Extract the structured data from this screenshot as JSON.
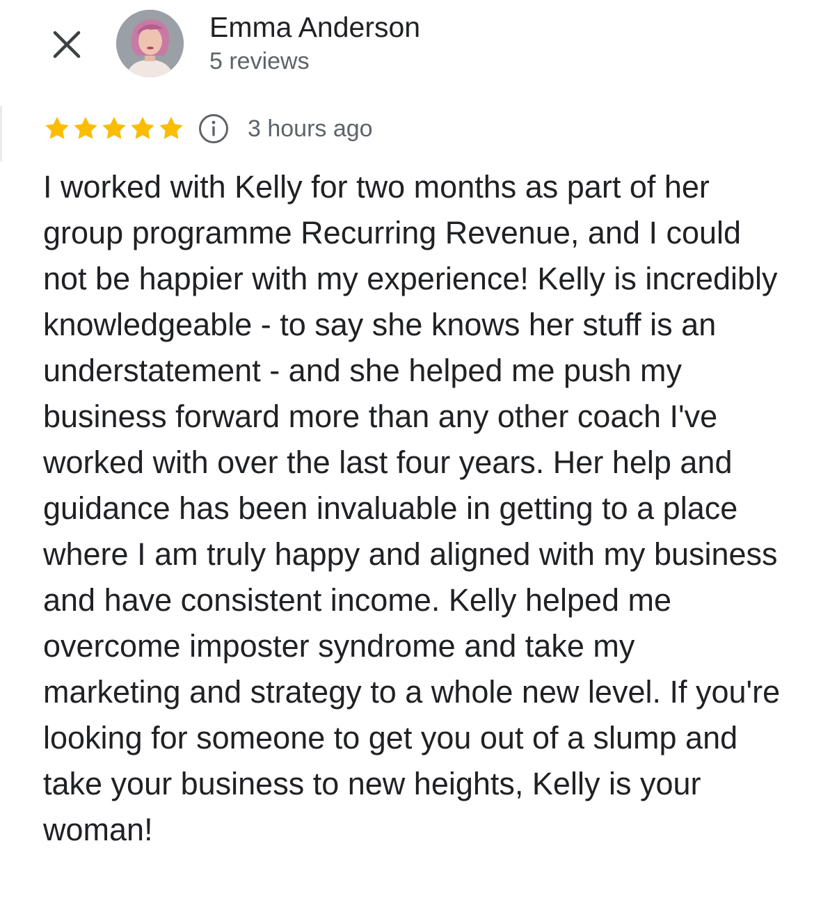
{
  "reviewer": {
    "name": "Emma Anderson",
    "review_count": "5 reviews"
  },
  "rating": {
    "stars": 5,
    "max_stars": 5,
    "time_ago": "3 hours ago"
  },
  "review": {
    "text": "I worked with Kelly for two months as part of her group programme Recurring Revenue, and I could not be happier with my experience! Kelly is incredibly knowledgeable - to say she knows her stuff is an understatement - and she helped me push my business forward more than any other coach I've worked with over the last four years. Her help and guidance has been invaluable in getting to a place where I am truly happy and aligned with my business and have consistent income. Kelly helped me overcome imposter syndrome and take my marketing and strategy to a whole new level. If you're looking for someone to get you out of a slump and take your business to new heights, Kelly is your woman!"
  },
  "icons": {
    "close": "close-icon",
    "star": "star-icon",
    "info": "info-icon"
  },
  "colors": {
    "star": "#fbbc04",
    "text_primary": "#202124",
    "text_secondary": "#5f6368",
    "avatar_hair": "#c77aa3"
  }
}
